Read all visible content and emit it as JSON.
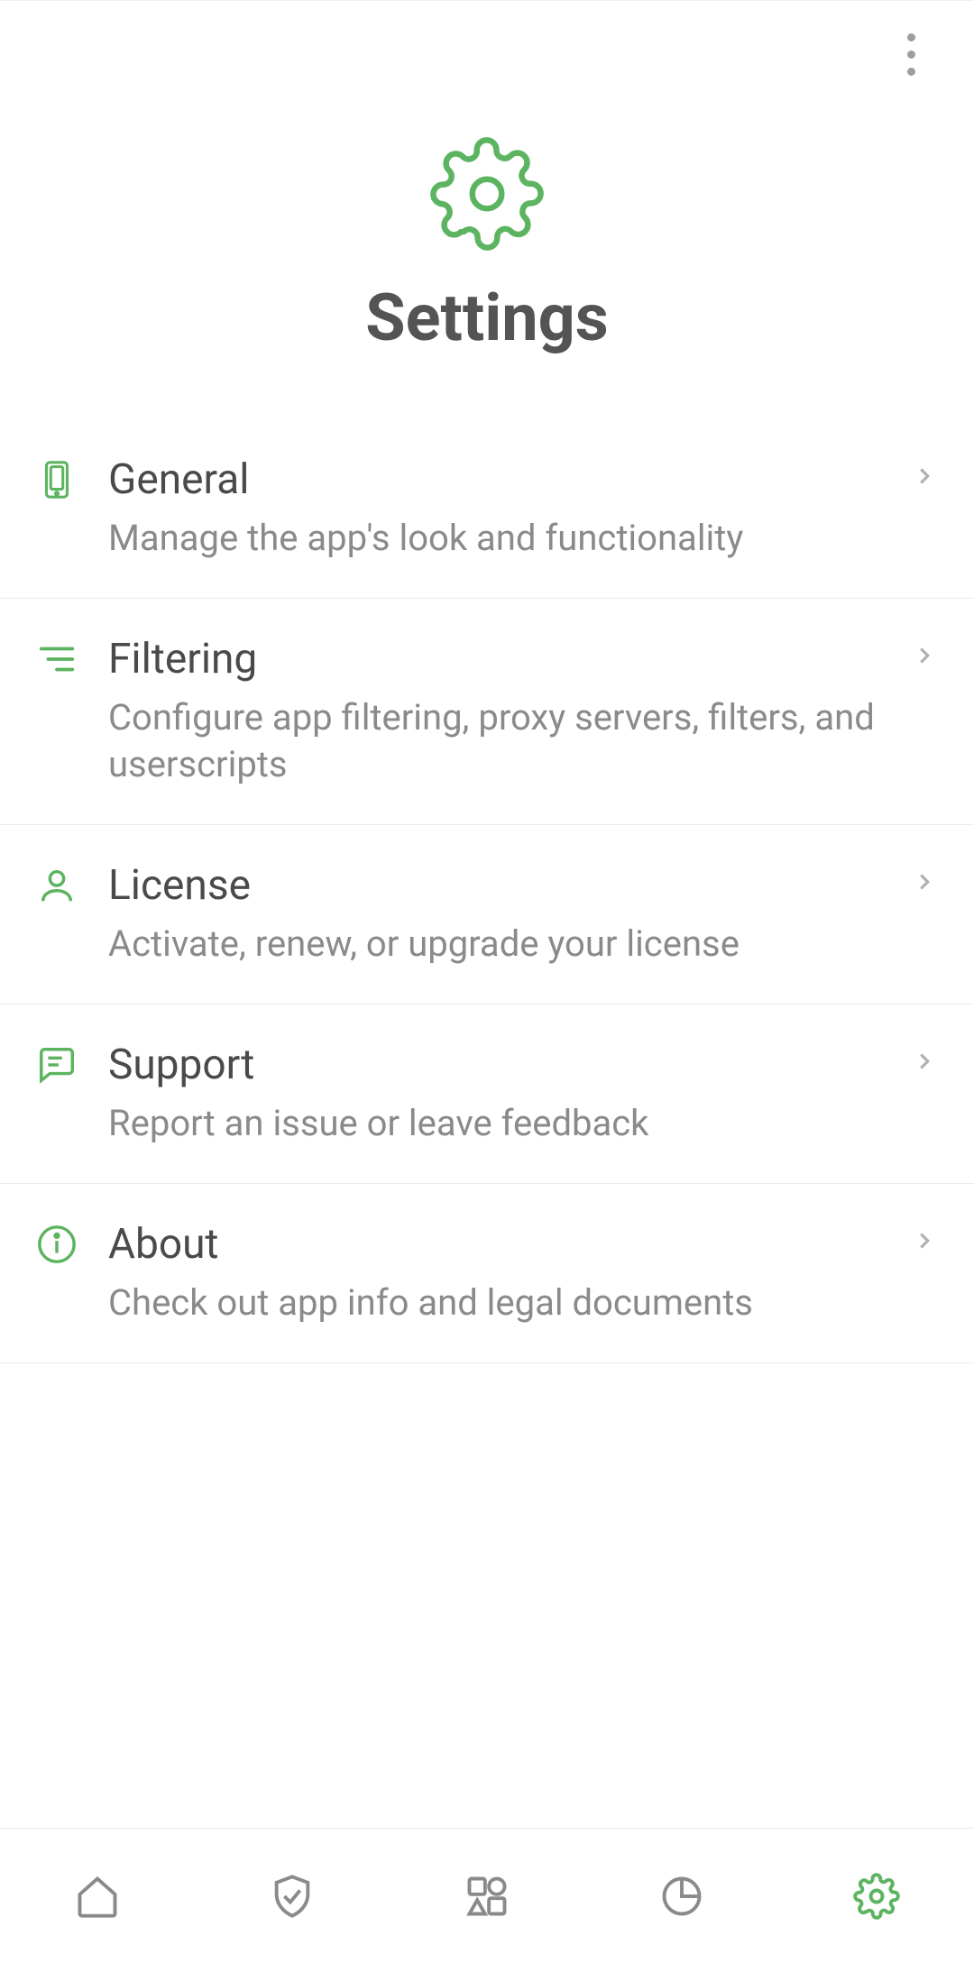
{
  "page": {
    "title": "Settings"
  },
  "rows": [
    {
      "title": "General",
      "sub": "Manage the app's look and functionality"
    },
    {
      "title": "Filtering",
      "sub": "Configure app filtering, proxy servers, filters, and userscripts"
    },
    {
      "title": "License",
      "sub": "Activate, renew, or upgrade your license"
    },
    {
      "title": "Support",
      "sub": "Report an issue or leave feedback"
    },
    {
      "title": "About",
      "sub": "Check out app info and legal documents"
    }
  ],
  "colors": {
    "accent": "#5CB460",
    "icon_gray": "#8a8a8a"
  }
}
